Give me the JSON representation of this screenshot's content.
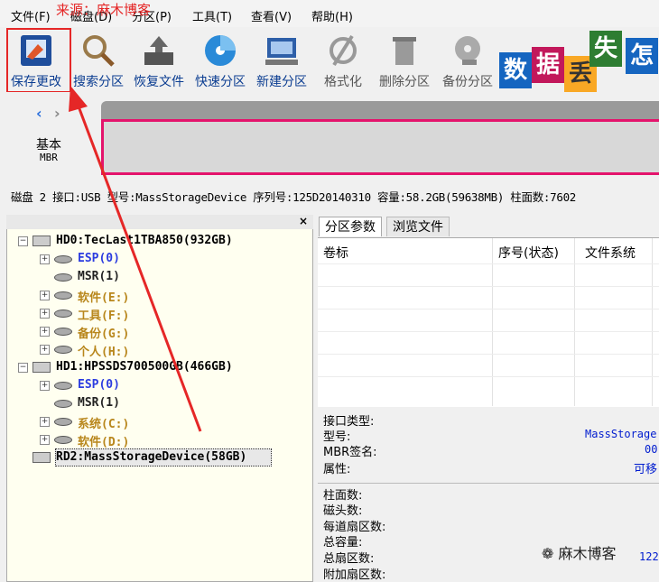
{
  "menubar": {
    "items": [
      "文件(F)",
      "磁盘(D)",
      "分区(P)",
      "工具(T)",
      "查看(V)",
      "帮助(H)"
    ]
  },
  "watermark_top": "来源：麻木博客",
  "toolbar": {
    "items": [
      {
        "label": "保存更改",
        "icon": "save-icon"
      },
      {
        "label": "搜索分区",
        "icon": "search-icon"
      },
      {
        "label": "恢复文件",
        "icon": "recover-file-icon"
      },
      {
        "label": "快速分区",
        "icon": "quick-partition-icon"
      },
      {
        "label": "新建分区",
        "icon": "new-partition-icon"
      },
      {
        "label": "格式化",
        "icon": "format-icon"
      },
      {
        "label": "删除分区",
        "icon": "delete-partition-icon"
      },
      {
        "label": "备份分区",
        "icon": "backup-partition-icon"
      }
    ]
  },
  "banner": {
    "chars": [
      "数",
      "据",
      "丢",
      "失",
      "怎"
    ]
  },
  "disk_map": {
    "type": "基本",
    "style": "MBR"
  },
  "disk_info": "磁盘 2 接口:USB  型号:MassStorageDevice  序列号:125D20140310  容量:58.2GB(59638MB)  柱面数:7602",
  "tree": {
    "items": [
      {
        "text": "HD0:TecLast1TBA850(932GB)",
        "kind": "disk"
      },
      {
        "text": "ESP(0)",
        "kind": "esp"
      },
      {
        "text": "MSR(1)",
        "kind": "msr"
      },
      {
        "text": "软件(E:)",
        "kind": "part"
      },
      {
        "text": "工具(F:)",
        "kind": "part"
      },
      {
        "text": "备份(G:)",
        "kind": "part"
      },
      {
        "text": "个人(H:)",
        "kind": "part"
      },
      {
        "text": "HD1:HPSSDS700500GB(466GB)",
        "kind": "disk"
      },
      {
        "text": "ESP(0)",
        "kind": "esp"
      },
      {
        "text": "MSR(1)",
        "kind": "msr"
      },
      {
        "text": "系统(C:)",
        "kind": "part"
      },
      {
        "text": "软件(D:)",
        "kind": "part"
      },
      {
        "text": "RD2:MassStorageDevice(58GB)",
        "kind": "disk"
      }
    ]
  },
  "tabs": [
    "分区参数",
    "浏览文件"
  ],
  "grid": {
    "columns": [
      "卷标",
      "序号(状态)",
      "文件系统"
    ]
  },
  "properties": {
    "interface_type": "接口类型:",
    "model": "型号:",
    "model_value": "MassStorage",
    "mbr_signature": "MBR签名:",
    "mbr_signature_value": "00",
    "attribute": "属性:",
    "attribute_value": "可移",
    "cylinders": "柱面数:",
    "heads": "磁头数:",
    "sectors_per_track": "每道扇区数:",
    "total_capacity": "总容量:",
    "total_sectors": "总扇区数:",
    "total_sectors_value": "122",
    "extra_sectors": "附加扇区数:"
  },
  "wechat_watermark": "麻木博客",
  "colors": {
    "highlight_red": "#e52727",
    "link_blue": "#2b3ce0",
    "partition_orange": "#b8861b",
    "disk_border": "#e4146c"
  }
}
